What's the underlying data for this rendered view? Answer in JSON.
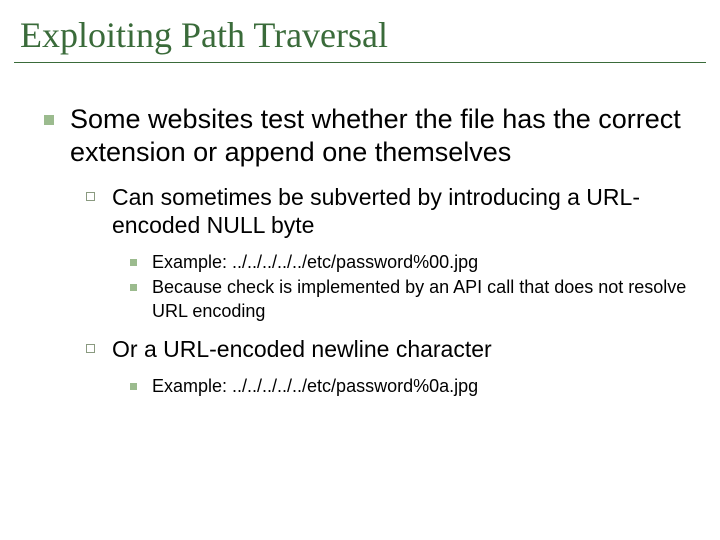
{
  "title": "Exploiting Path Traversal",
  "b1": "Some websites test whether the file has the correct extension or append one themselves",
  "b1_1": "Can sometimes be subverted by introducing a URL-encoded NULL byte",
  "b1_1_1": "Example: ../../../../../etc/password%00.jpg",
  "b1_1_2": "Because check is implemented by an API call that does not resolve URL encoding",
  "b1_2": "Or a URL-encoded newline character",
  "b1_2_1": "Example: ../../../../../etc/password%0a.jpg"
}
